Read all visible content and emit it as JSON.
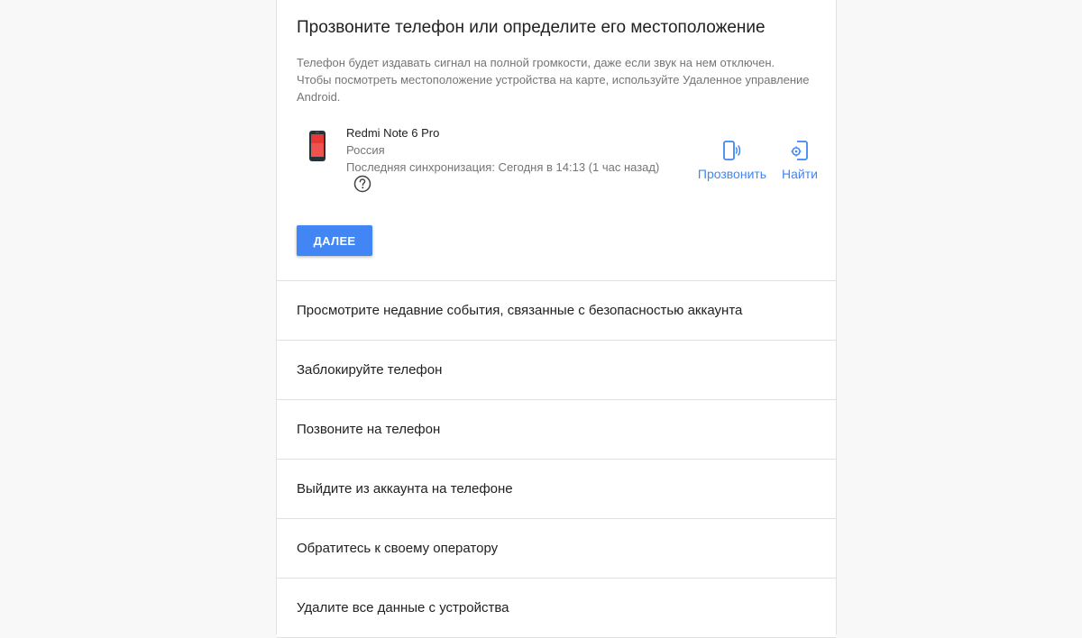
{
  "section": {
    "title": "Прозвоните телефон или определите его местоположение",
    "description": "Телефон будет издавать сигнал на полной громкости, даже если звук на нем отключен. Чтобы посмотреть местоположение устройства на карте, используйте Удаленное управление Android."
  },
  "device": {
    "name": "Redmi Note 6 Pro",
    "country": "Россия",
    "last_sync": "Последняя синхронизация: Сегодня в 14:13 (1 час назад)",
    "icon": "phone-device-icon"
  },
  "actions": {
    "ring_label": "Прозвонить",
    "ring_icon": "phone-ring-icon",
    "find_label": "Найти",
    "find_icon": "phone-locate-icon"
  },
  "next_button": "ДАЛЕЕ",
  "rows": [
    "Просмотрите недавние события, связанные с безопасностью аккаунта",
    "Заблокируйте телефон",
    "Позвоните на телефон",
    "Выйдите из аккаунта на телефоне",
    "Обратитесь к своему оператору",
    "Удалите все данные с устройства"
  ],
  "colors": {
    "accent": "#4285f4",
    "background": "#f8f8f8",
    "card": "#ffffff",
    "divider": "#e0e0e0"
  }
}
